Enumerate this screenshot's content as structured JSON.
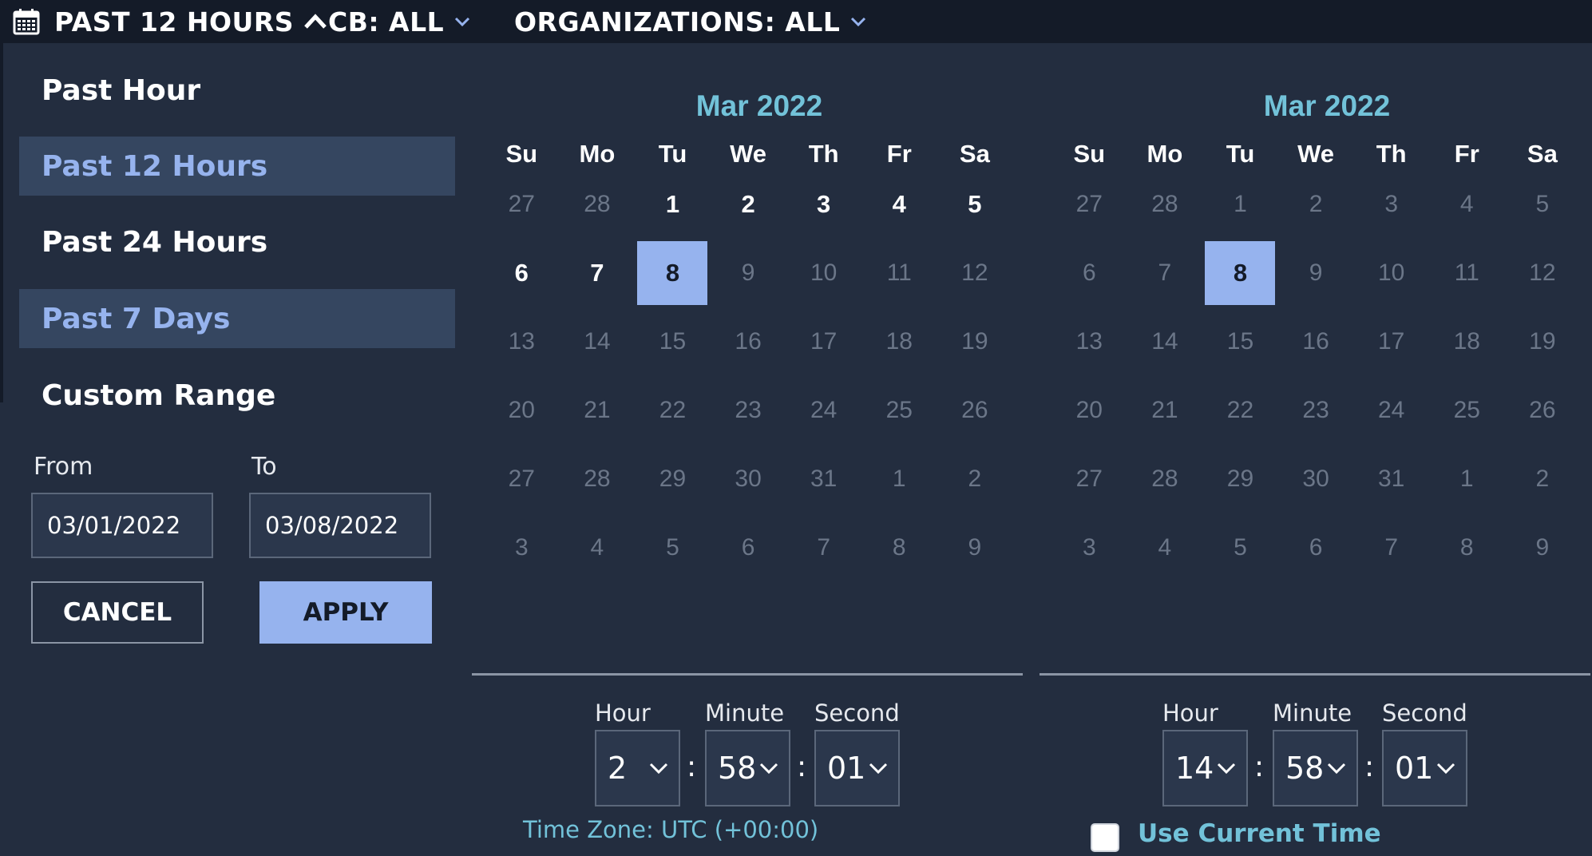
{
  "topbar": {
    "time_range_label": "PAST 12 HOURS",
    "cb_label": "CB: ALL",
    "org_label": "ORGANIZATIONS: ALL",
    "icons": [
      "calendar-icon",
      "chevron-up-icon",
      "chevron-down-icon"
    ]
  },
  "presets": [
    {
      "label": "Past Hour",
      "active": false
    },
    {
      "label": "Past 12 Hours",
      "active": true
    },
    {
      "label": "Past 24 Hours",
      "active": false
    },
    {
      "label": "Past 7 Days",
      "active": true
    },
    {
      "label": "Custom Range",
      "active": false
    }
  ],
  "range": {
    "from_label": "From",
    "to_label": "To",
    "from_value": "03/01/2022",
    "to_value": "03/08/2022",
    "cancel_label": "CANCEL",
    "apply_label": "APPLY"
  },
  "weekdays": [
    "Su",
    "Mo",
    "Tu",
    "We",
    "Th",
    "Fr",
    "Sa"
  ],
  "calendars": [
    {
      "title": "Mar 2022",
      "selected_day": "8",
      "weeks": [
        [
          "27",
          "28",
          "1",
          "2",
          "3",
          "4",
          "5"
        ],
        [
          "6",
          "7",
          "8",
          "9",
          "10",
          "11",
          "12"
        ],
        [
          "13",
          "14",
          "15",
          "16",
          "17",
          "18",
          "19"
        ],
        [
          "20",
          "21",
          "22",
          "23",
          "24",
          "25",
          "26"
        ],
        [
          "27",
          "28",
          "29",
          "30",
          "31",
          "1",
          "2"
        ],
        [
          "3",
          "4",
          "5",
          "6",
          "7",
          "8",
          "9"
        ]
      ],
      "active_days": [
        [
          2,
          3,
          4,
          5,
          6
        ],
        [
          0,
          1,
          2
        ]
      ],
      "time": {
        "hour": "2",
        "minute": "58",
        "second": "01"
      }
    },
    {
      "title": "Mar 2022",
      "selected_day": "8",
      "weeks": [
        [
          "27",
          "28",
          "1",
          "2",
          "3",
          "4",
          "5"
        ],
        [
          "6",
          "7",
          "8",
          "9",
          "10",
          "11",
          "12"
        ],
        [
          "13",
          "14",
          "15",
          "16",
          "17",
          "18",
          "19"
        ],
        [
          "20",
          "21",
          "22",
          "23",
          "24",
          "25",
          "26"
        ],
        [
          "27",
          "28",
          "29",
          "30",
          "31",
          "1",
          "2"
        ],
        [
          "3",
          "4",
          "5",
          "6",
          "7",
          "8",
          "9"
        ]
      ],
      "active_days": [
        [],
        [
          2
        ]
      ],
      "time": {
        "hour": "14",
        "minute": "58",
        "second": "01"
      }
    }
  ],
  "time_labels": {
    "hour": "Hour",
    "minute": "Minute",
    "second": "Second"
  },
  "colon": ":",
  "timezone": "Time Zone: UTC (+00:00)",
  "use_current_time": {
    "label": "Use Current Time",
    "checked": false
  },
  "colors": {
    "background": "#232d3f",
    "topbar": "#141b28",
    "accent": "#96b3ee",
    "highlight_text": "#72c2d9",
    "preset_active_bg": "#354660"
  }
}
